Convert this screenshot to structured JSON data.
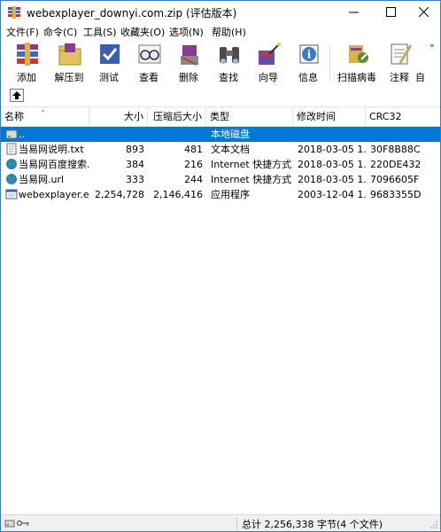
{
  "window": {
    "title": "webexplayer_downyi.com.zip (评估版本)"
  },
  "menu": [
    {
      "label": "文件(F)"
    },
    {
      "label": "命令(C)"
    },
    {
      "label": "工具(S)"
    },
    {
      "label": "收藏夹(O)"
    },
    {
      "label": "选项(N)"
    },
    {
      "label": "帮助(H)"
    }
  ],
  "toolbar": [
    {
      "label": "添加",
      "icon": "add-books-icon",
      "color": "#8b3a8f"
    },
    {
      "label": "解压到",
      "icon": "extract-folder-icon",
      "color": "#d4a437"
    },
    {
      "label": "测试",
      "icon": "test-icon",
      "color": "#3a5fb0"
    },
    {
      "label": "查看",
      "icon": "glasses-icon",
      "color": "#7a7a7a"
    },
    {
      "label": "删除",
      "icon": "delete-icon",
      "color": "#b03a3a"
    },
    {
      "label": "查找",
      "icon": "binoculars-icon",
      "color": "#4a4a4a"
    },
    {
      "label": "向导",
      "icon": "wizard-icon",
      "color": "#6b4aa8"
    },
    {
      "label": "信息",
      "icon": "info-icon",
      "color": "#3a7ac8"
    },
    {
      "label": "扫描病毒",
      "icon": "scan-virus-icon",
      "color": "#5a8a3a"
    },
    {
      "label": "注释",
      "icon": "comment-icon",
      "color": "#c8a85a"
    },
    {
      "label": "自",
      "icon": "sfx-icon",
      "color": "#888888"
    }
  ],
  "list": {
    "columns": {
      "name": "名称",
      "size": "大小",
      "packed": "压缩后大小",
      "type": "类型",
      "modified": "修改时间",
      "crc": "CRC32"
    },
    "rows": [
      {
        "name": "..",
        "size": "",
        "packed": "",
        "type": "本地磁盘",
        "modified": "",
        "crc": "",
        "icon": "drive-icon"
      },
      {
        "name": "当易网说明.txt",
        "size": "893",
        "packed": "481",
        "type": "文本文档",
        "modified": "2018-03-05 1...",
        "crc": "30F8B88C",
        "icon": "text-file-icon"
      },
      {
        "name": "当易网百度搜索...",
        "size": "384",
        "packed": "216",
        "type": "Internet 快捷方式",
        "modified": "2018-03-05 1...",
        "crc": "220DE432",
        "icon": "globe-icon"
      },
      {
        "name": "当易网.url",
        "size": "333",
        "packed": "244",
        "type": "Internet 快捷方式",
        "modified": "2018-03-05 1...",
        "crc": "7096605F",
        "icon": "globe-icon"
      },
      {
        "name": "webexplayer.exe",
        "size": "2,254,728",
        "packed": "2,146,416",
        "type": "应用程序",
        "modified": "2003-12-04 1...",
        "crc": "9683355D",
        "icon": "exe-icon"
      }
    ]
  },
  "status": {
    "text": "总计 2,256,338 字节(4 个文件)"
  },
  "colors": {
    "selection": "#0078d7",
    "window_border": "#3b7ad1"
  }
}
